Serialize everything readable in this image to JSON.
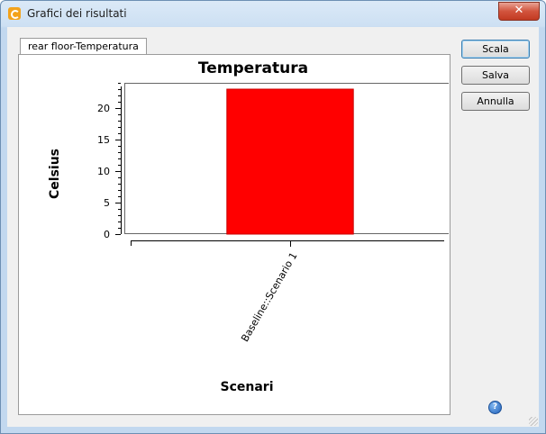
{
  "window": {
    "title": "Grafici dei risultati",
    "app_icon": "app-logo-icon",
    "close_label": "✕"
  },
  "tabs": [
    {
      "label": "rear floor-Temperatura",
      "active": true
    }
  ],
  "buttons": {
    "scale_label": "Scala",
    "save_label": "Salva",
    "cancel_label": "Annulla"
  },
  "help_icon": {
    "glyph": "?"
  },
  "chart_data": {
    "type": "bar",
    "title": "Temperatura",
    "xlabel": "Scenari",
    "ylabel": "Celsius",
    "categories": [
      "Baseline::Scenario 1"
    ],
    "values": [
      23
    ],
    "ylim": [
      0,
      24
    ],
    "yticks": [
      0,
      5,
      10,
      15,
      20
    ],
    "bar_color": "#ff0000",
    "grid": false,
    "legend": "none"
  }
}
